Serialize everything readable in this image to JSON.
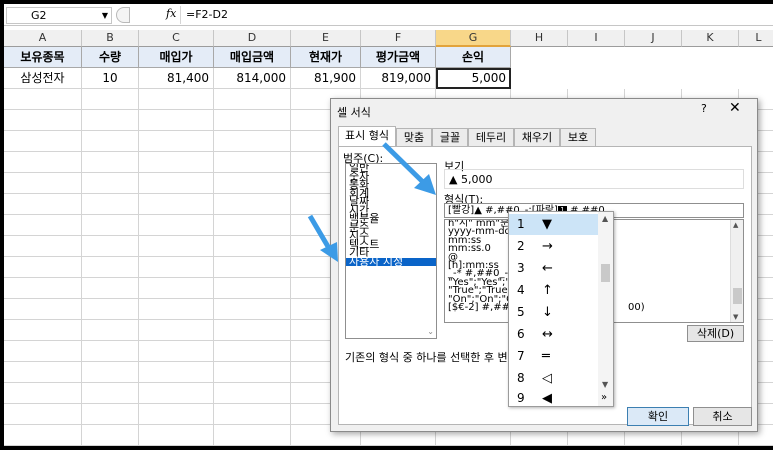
{
  "formula_bar": {
    "name_box": "G2",
    "fx": "fx",
    "formula": "=F2-D2"
  },
  "columns": [
    "A",
    "B",
    "C",
    "D",
    "E",
    "F",
    "G",
    "H",
    "I",
    "J",
    "K",
    "L"
  ],
  "sheet": {
    "headers": [
      "보유종목",
      "수량",
      "매입가",
      "매입금액",
      "현재가",
      "평가금액",
      "손익"
    ],
    "row2": [
      "삼성전자",
      "10",
      "81,400",
      "814,000",
      "81,900",
      "819,000",
      "5,000"
    ]
  },
  "dialog": {
    "title": "셀 서식",
    "help": "?",
    "close": "✕",
    "tabs": [
      "표시 형식",
      "맞춤",
      "글꼴",
      "테두리",
      "채우기",
      "보호"
    ],
    "category_label": "범주(C):",
    "categories": [
      "일반",
      "숫자",
      "통화",
      "회계",
      "날짜",
      "시간",
      "백분율",
      "분수",
      "지수",
      "텍스트",
      "기타",
      "사용자 지정"
    ],
    "selected_category": "사용자 지정",
    "sample_label": "보기",
    "sample_value": "▲ 5,000",
    "type_label": "형식(T):",
    "type_prefix": "[빨강]▲ #,##0_-;[파랑]",
    "type_box_char": "1",
    "type_suffix": " #,##0",
    "format_list": [
      "h\"시\" mm\"분\" ss",
      "yyyy-mm-dd h",
      "mm:ss",
      "mm:ss.0",
      "@",
      "[h]:mm:ss",
      "_-* #,##0_-;[빨강]-",
      "\"Yes\";\"Yes\";\"No",
      "\"True\";\"True\";\"F",
      "\"On\";\"On\";\"Off\"",
      "[$€-2] #,##0.00"
    ],
    "format_list_tail": "00)",
    "delete_button": "삭제(D)",
    "description": "기존의 형식 중 하나를 선택한 후 변형시킵니다.",
    "ok_button": "확인",
    "cancel_button": "취소"
  },
  "symbol_popup": {
    "items": [
      {
        "num": "1",
        "char": "▼"
      },
      {
        "num": "2",
        "char": "→"
      },
      {
        "num": "3",
        "char": "←"
      },
      {
        "num": "4",
        "char": "↑"
      },
      {
        "num": "5",
        "char": "↓"
      },
      {
        "num": "6",
        "char": "↔"
      },
      {
        "num": "7",
        "char": "═"
      },
      {
        "num": "8",
        "char": "◁"
      },
      {
        "num": "9",
        "char": "◀"
      }
    ],
    "more": "»"
  },
  "colors": {
    "arrow": "#3c9be6",
    "selected_bg": "#0a64c8",
    "header_bg": "#e4ecf7"
  }
}
